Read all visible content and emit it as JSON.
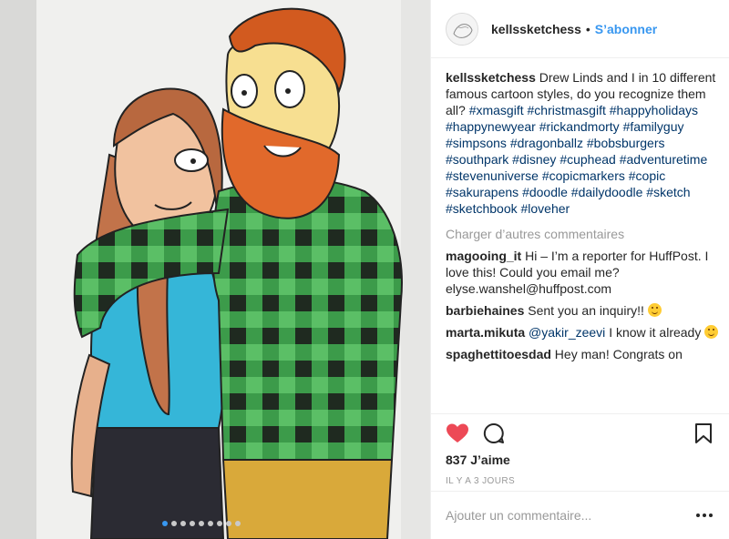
{
  "post": {
    "username": "kellssketchess",
    "separator": "•",
    "follow_label": "S’abonner",
    "caption_user": "kellssketchess",
    "caption_text": "Drew Linds and I in 10 different famous cartoon styles, do you recognize them all?",
    "hashtags": [
      "#xmasgift",
      "#christmasgift",
      "#happyholidays",
      "#happynewyear",
      "#rickandmorty",
      "#familyguy",
      "#simpsons",
      "#dragonballz",
      "#bobsburgers",
      "#southpark",
      "#disney",
      "#cuphead",
      "#adventuretime",
      "#stevenuniverse",
      "#copicmarkers",
      "#copic",
      "#sakurapens",
      "#doodle",
      "#dailydoodle",
      "#sketch",
      "#sketchbook",
      "#loveher"
    ],
    "load_more": "Charger d’autres commentaires",
    "comments": [
      {
        "user": "magooing_it",
        "text": "Hi – I’m a reporter for HuffPost. I love this! Could you email me? elyse.wanshel@huffpost.com",
        "emoji": ""
      },
      {
        "user": "barbiehaines",
        "text": "Sent you an inquiry!!",
        "emoji": "smiling-emoji"
      },
      {
        "user": "marta.mikuta",
        "mention": "@yakir_zeevi",
        "text": "I know it already",
        "emoji": "tongue-emoji"
      },
      {
        "user": "spaghettitoesdad",
        "text": "Hey man! Congrats on",
        "emoji": ""
      }
    ],
    "likes": "837 J’aime",
    "timestamp": "IL Y A 3 JOURS",
    "add_comment_placeholder": "Ajouter un commentaire...",
    "icons": {
      "like": "heart-icon",
      "comment": "comment-icon",
      "save": "bookmark-icon",
      "more": "more-options-icon"
    },
    "colors": {
      "accent": "#3897f0",
      "hashtag": "#003569",
      "liked": "#ed4956",
      "muted": "#999999"
    },
    "carousel": {
      "count": 9,
      "active": 1
    }
  }
}
